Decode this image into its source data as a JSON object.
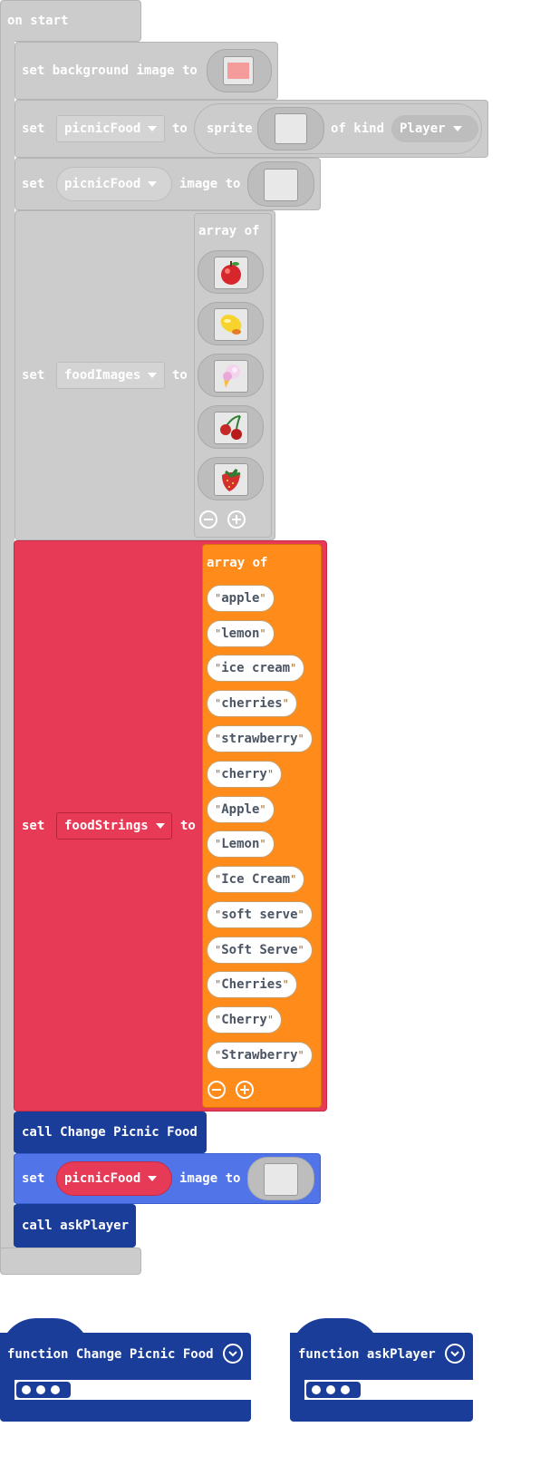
{
  "on_start": {
    "label": "on start",
    "set_bg": {
      "label": "set background image to"
    },
    "set_sprite": {
      "set": "set",
      "var": "picnicFood",
      "to": "to",
      "sprite": "sprite",
      "of_kind": "of kind",
      "kind": "Player"
    },
    "set_image": {
      "set": "set",
      "var": "picnicFood",
      "image_to": "image to"
    },
    "set_food_images": {
      "set": "set",
      "var": "foodImages",
      "to": "to",
      "array_of": "array of",
      "items": [
        "apple-icon",
        "lemon-icon",
        "ice-cream-icon",
        "cherries-icon",
        "strawberry-icon"
      ]
    },
    "set_food_strings": {
      "set": "set",
      "var": "foodStrings",
      "to": "to",
      "array_of": "array of",
      "items": [
        "apple",
        "lemon",
        "ice cream",
        "cherries",
        "strawberry",
        "cherry",
        "Apple",
        "Lemon",
        "Ice Cream",
        "soft serve",
        "Soft Serve",
        "Cherries",
        "Cherry",
        "Strawberry"
      ]
    },
    "call_change": {
      "label": "call Change Picnic Food"
    },
    "set_image2": {
      "set": "set",
      "var": "picnicFood",
      "image_to": "image to"
    },
    "call_ask": {
      "label": "call askPlayer"
    }
  },
  "functions": [
    {
      "label": "function Change Picnic Food"
    },
    {
      "label": "function askPlayer"
    }
  ],
  "colors": {
    "disabled": "#cccccc",
    "red": "#e73a57",
    "orange": "#ff8c1a",
    "navy": "#1a3d99",
    "blue": "#5175e8"
  }
}
